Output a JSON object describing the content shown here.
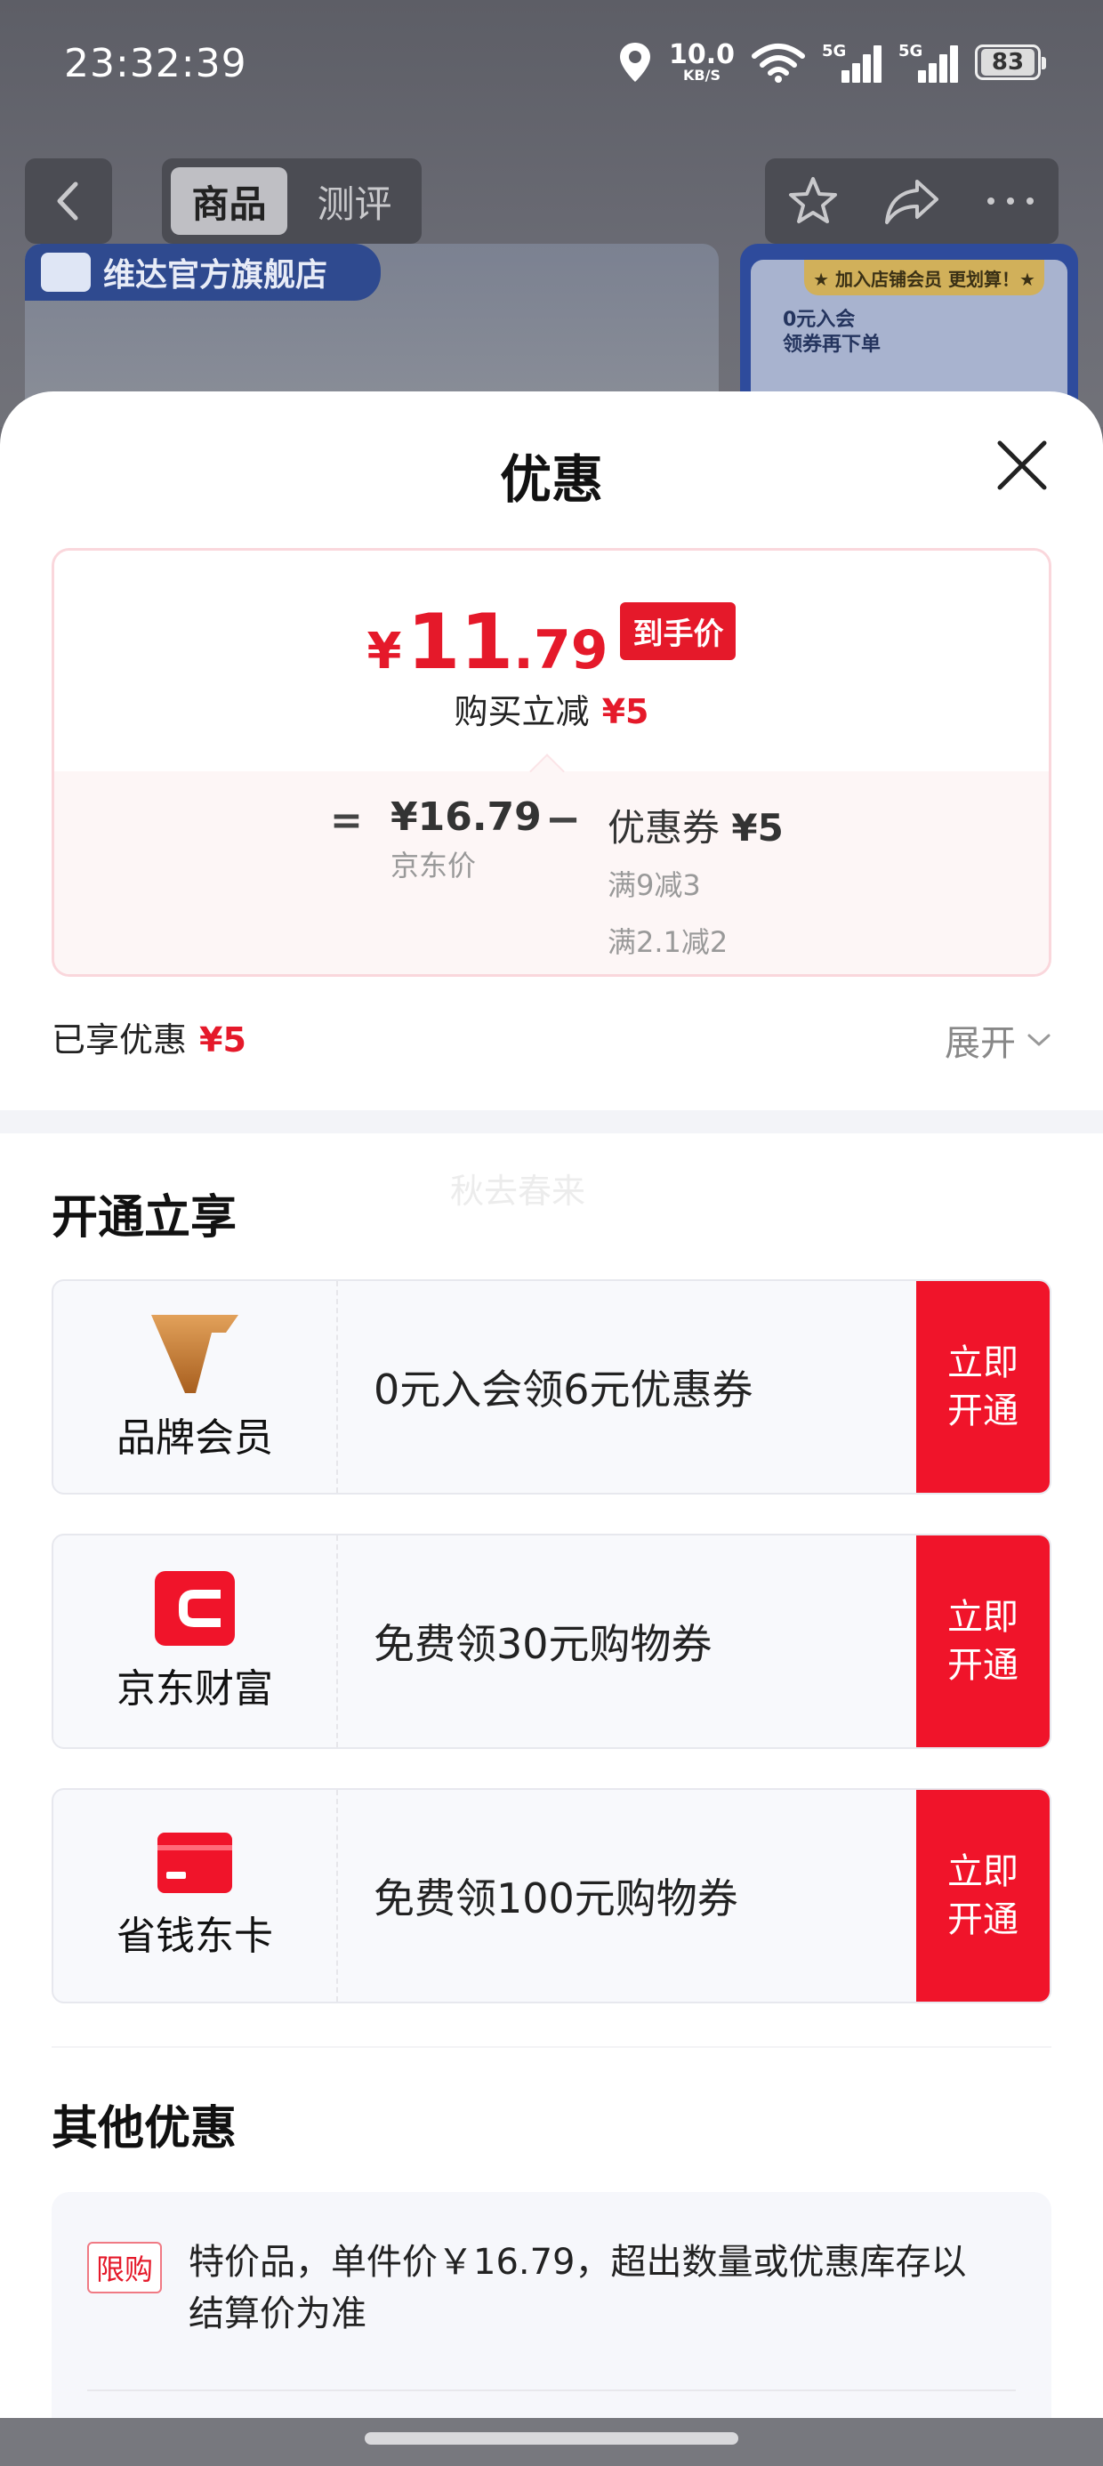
{
  "status_bar": {
    "time": "23:32:39",
    "net_speed_value": "10.0",
    "net_speed_unit": "KB/S",
    "sim1_label": "5G",
    "sim2_label": "5G",
    "battery": "83"
  },
  "nav": {
    "tab_product": "商品",
    "tab_review": "测评"
  },
  "background": {
    "store_name": "维达官方旗舰店",
    "promo_title": "★ 加入店铺会员 更划算！★",
    "promo_text_1": "0元入会",
    "promo_text_2": "领券再下单"
  },
  "sheet": {
    "title": "优惠",
    "price": {
      "currency": "¥",
      "integer": "11",
      "decimal": ".79",
      "tag": "到手价",
      "instant_label": "购买立减",
      "instant_value": "¥5",
      "equals": "=",
      "jd_price": "¥16.79",
      "jd_price_label": "京东价",
      "minus": "−",
      "coupon_label": "优惠券",
      "coupon_value": "¥5",
      "rule_1": "满9减3",
      "rule_2": "满2.1减2"
    },
    "enjoyed_label": "已享优惠",
    "enjoyed_value": "¥5",
    "expand_label": "展开",
    "section_open": "开通立享",
    "watermark": "秋去春来",
    "offers": [
      {
        "name": "品牌会员",
        "desc": "0元入会领6元优惠券",
        "btn_1": "立即",
        "btn_2": "开通",
        "icon": "brand-v-icon"
      },
      {
        "name": "京东财富",
        "desc": "免费领30元购物券",
        "btn_1": "立即",
        "btn_2": "开通",
        "icon": "jd-wealth-icon"
      },
      {
        "name": "省钱东卡",
        "desc": "免费领100元购物券",
        "btn_1": "立即",
        "btn_2": "开通",
        "icon": "card-icon"
      }
    ],
    "section_other": "其他优惠",
    "limit_tag": "限购",
    "limit_text": "特价品，单件价￥16.79，超出数量或优惠库存以结算价为准"
  },
  "colors": {
    "accent_red": "#e5192a",
    "button_red": "#f0142a",
    "brand_gold": "#c8812f"
  }
}
